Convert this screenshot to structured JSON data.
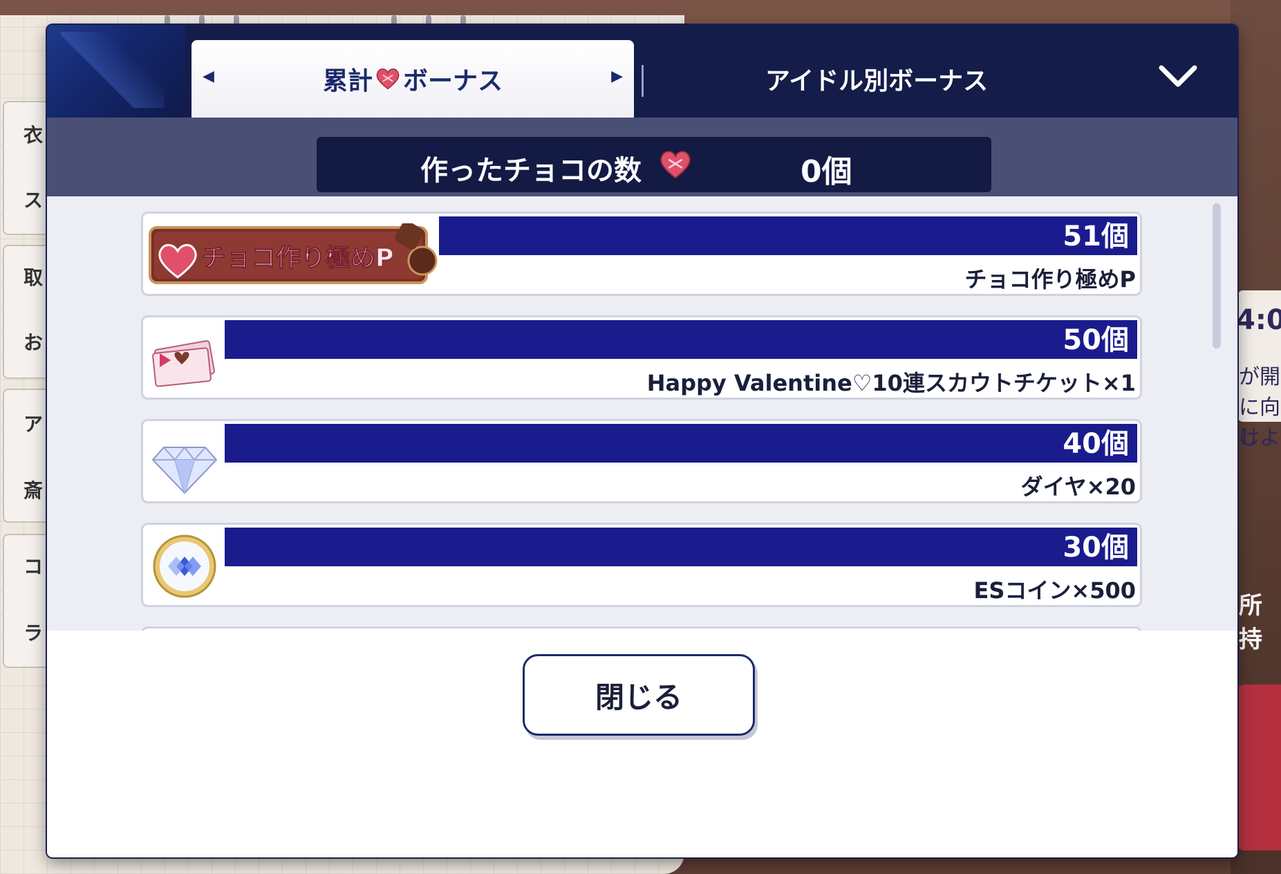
{
  "tabs": {
    "cumulative_label_left": "累計",
    "cumulative_label_right": "ボーナス",
    "idol_label": "アイドル別ボーナス"
  },
  "counter": {
    "label": "作ったチョコの数",
    "value": "0個"
  },
  "rewards": [
    {
      "threshold": "51個",
      "name": "チョコ作り極めP",
      "badge_text": "チョコ作り極めP",
      "icon": "title-badge-icon"
    },
    {
      "threshold": "50個",
      "name": "Happy Valentine♡10連スカウトチケット×1",
      "icon": "scout-ticket-icon"
    },
    {
      "threshold": "40個",
      "name": "ダイヤ×20",
      "icon": "diamond-icon"
    },
    {
      "threshold": "30個",
      "name": "ESコイン×500",
      "icon": "es-coin-icon"
    }
  ],
  "footer": {
    "close_label": "閉じる"
  },
  "background": {
    "left_tabs": [
      "衣",
      "ス",
      "取",
      "お",
      "ア",
      "斎",
      "コ",
      "ラ"
    ],
    "right_time": "4:0",
    "right_lines": [
      "が開",
      "に向け",
      "しよ"
    ],
    "right_label": "所持"
  },
  "colors": {
    "header": "#141c49",
    "count_band": "#4a5075",
    "reward_bar": "#1a1c8e",
    "accent_heart": "#e0506a"
  }
}
